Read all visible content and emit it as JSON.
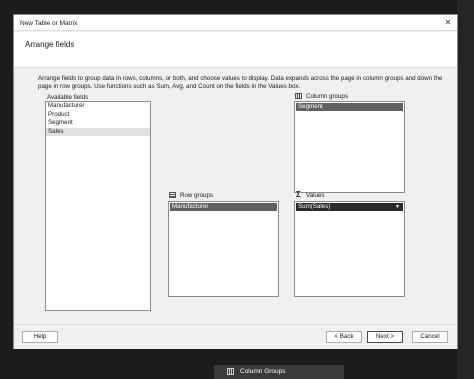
{
  "window": {
    "title": "New Table or Matrix",
    "close_glyph": "✕"
  },
  "header": {
    "title": "Arrange fields"
  },
  "description": "Arrange fields to group data in rows, columns, or both, and choose values to display. Data expands across the page in column groups and down the page in row groups.  Use functions such as Sum, Avg, and Count on the fields in the Values box.",
  "available_fields": {
    "label": "Available fields",
    "items": [
      "Manufacturer",
      "Product",
      "Segment",
      "Sales"
    ],
    "selected": "Sales"
  },
  "column_groups": {
    "label": "Column groups",
    "icon": "column-groups-icon",
    "items": [
      "Segment"
    ]
  },
  "row_groups": {
    "label": "Row groups",
    "icon": "row-groups-icon",
    "items": [
      "Manufacturer"
    ]
  },
  "values": {
    "label": "Values",
    "icon": "sigma-icon",
    "sigma_glyph": "Σ",
    "items": [
      "Sum(Sales)"
    ],
    "dropdown_glyph": "▼"
  },
  "footer": {
    "help_label": "Help",
    "back_label": "< Back",
    "next_label": "Next >",
    "cancel_label": "Cancel"
  },
  "taskbar": {
    "label": "Column Groups",
    "icon": "column-groups-icon"
  },
  "colors": {
    "dialog_bg": "#f0f0f0",
    "selected_item_bg": "#616161",
    "active_item_bg": "#2b2b2b",
    "outer_bg": "#1c1c1c"
  }
}
